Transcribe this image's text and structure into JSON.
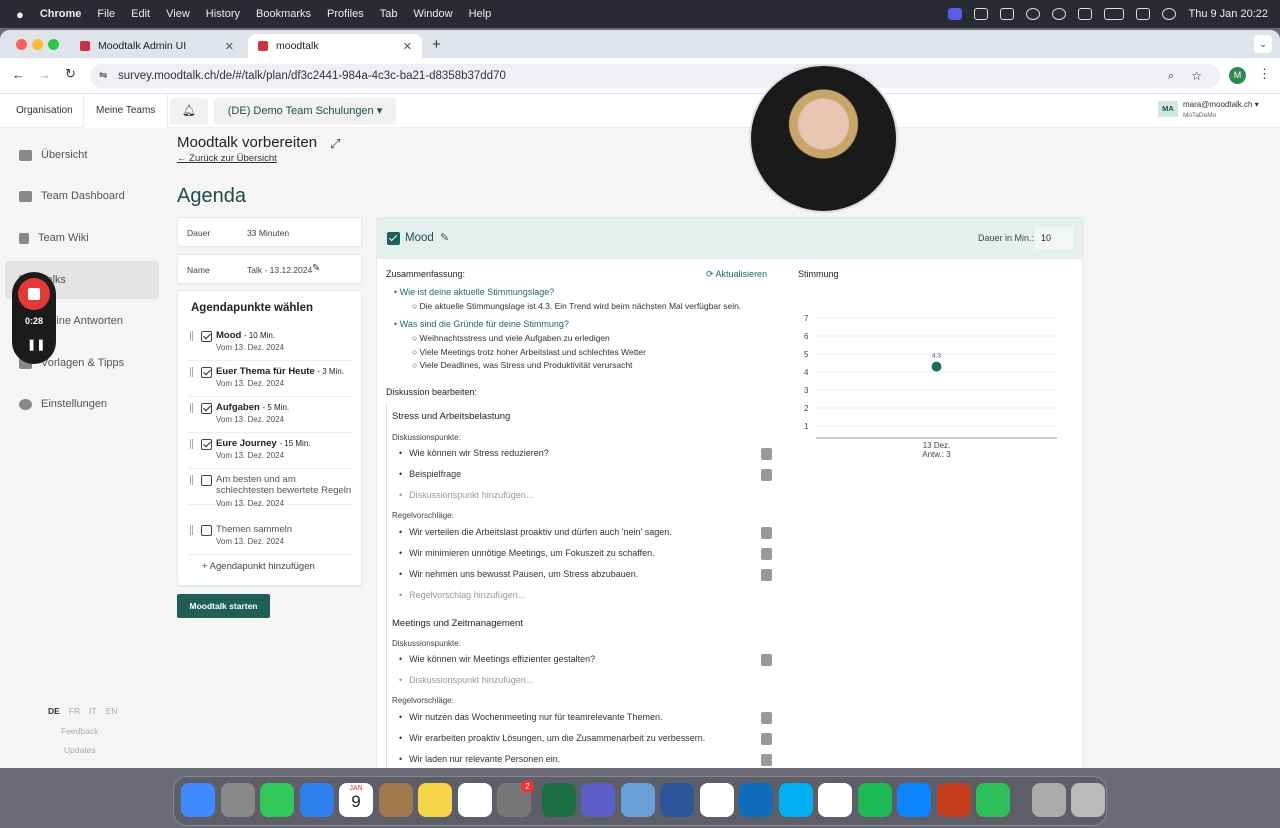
{
  "menubar": {
    "apple": "",
    "app": "Chrome",
    "items": [
      "File",
      "Edit",
      "View",
      "History",
      "Bookmarks",
      "Profiles",
      "Tab",
      "Window",
      "Help"
    ],
    "clock": "Thu 9 Jan  20:22"
  },
  "browser": {
    "tabs": [
      {
        "label": "Moodtalk Admin UI"
      },
      {
        "label": "moodtalk"
      }
    ],
    "url": "survey.moodtalk.ch/de/#/talk/plan/df3c2441-984a-4c3c-ba21-d8358b37dd70",
    "avatar": "M"
  },
  "topnav": {
    "tabs": [
      "Organisation",
      "Meine Teams"
    ],
    "team": "(DE) Demo Team Schulungen ▾",
    "user_initials": "MA",
    "user_email": "mara@moodtalk.ch ▾",
    "user_org": "MoTaDeMo"
  },
  "sidebar": {
    "items": [
      "Übersicht",
      "Team Dashboard",
      "Team Wiki",
      "Talks",
      "Meine Antworten",
      "Vorlagen & Tipps",
      "Einstellungen"
    ],
    "langs": [
      "DE",
      "FR",
      "IT",
      "EN"
    ],
    "feedback": "Feedback",
    "updates": "Updates"
  },
  "recorder": {
    "time": "0:28"
  },
  "page": {
    "title": "Moodtalk vorbereiten",
    "back": "← Zurück zur Übersicht",
    "heading": "Agenda"
  },
  "meta": {
    "duration_label": "Dauer",
    "duration_value": "33 Minuten",
    "name_label": "Name",
    "name_value": "Talk - 13.12.2024"
  },
  "agenda": {
    "title": "Agendapunkte wählen",
    "items": [
      {
        "title": "Mood",
        "dur": "10 Min.",
        "date": "Vom 13. Dez. 2024",
        "checked": true
      },
      {
        "title": "Euer Thema für Heute",
        "dur": "3 Min.",
        "date": "Vom 13. Dez. 2024",
        "checked": true
      },
      {
        "title": "Aufgaben",
        "dur": "5 Min.",
        "date": "Vom 13. Dez. 2024",
        "checked": true
      },
      {
        "title": "Eure Journey",
        "dur": "15 Min.",
        "date": "Vom 13. Dez. 2024",
        "checked": true
      },
      {
        "title": "Am besten und am schlechtesten bewertete Regeln",
        "dur": "",
        "date": "Vom 13. Dez. 2024",
        "checked": false
      },
      {
        "title": "Themen sammeln",
        "dur": "",
        "date": "Vom 13. Dez. 2024",
        "checked": false
      }
    ],
    "add": "+ Agendapunkt hinzufügen",
    "start": "Moodtalk starten"
  },
  "mood": {
    "title": "Mood",
    "duration_label": "Dauer in Min.:",
    "duration": "10",
    "summary_label": "Zusammenfassung:",
    "refresh": "Aktualisieren",
    "q1": "Wie ist deine aktuelle Stimmungslage?",
    "a1": "Die aktuelle Stimmungslage ist 4.3. Ein Trend wird beim nächsten Mal verfügbar sein.",
    "q2": "Was sind die Gründe für deine Stimmung?",
    "a2": [
      "Weihnachtsstress und viele Aufgaben zu erledigen",
      "Viele Meetings trotz hoher Arbeitslast und schlechtes Wetter",
      "Viele Deadlines, was Stress und Produktivität verursacht"
    ],
    "edit_label": "Diskussion bearbeiten:",
    "topics": [
      {
        "title": "Stress und Arbeitsbelastung",
        "points_label": "Diskussionspunkte:",
        "points": [
          "Wie können wir Stress reduzieren?",
          "Beispielfrage"
        ],
        "add_point": "Diskussionspunkt hinzufügen...",
        "rules_label": "Regelvorschläge:",
        "rules": [
          "Wir verteilen die Arbeitslast proaktiv und dürfen auch 'nein' sagen.",
          "Wir minimieren unnötige Meetings, um Fokuszeit zu schaffen.",
          "Wir nehmen uns bewusst Pausen, um Stress abzubauen."
        ],
        "add_rule": "Regelvorschlag hinzufügen..."
      },
      {
        "title": "Meetings und Zeitmanagement",
        "points_label": "Diskussionspunkte:",
        "points": [
          "Wie können wir Meetings effizienter gestalten?"
        ],
        "add_point": "Diskussionspunkt hinzufügen...",
        "rules_label": "Regelvorschläge:",
        "rules": [
          "Wir nutzen das Wochenmeeting nur für teamrelevante Themen.",
          "Wir erarbeiten proaktiv Lösungen, um die Zusammenarbeit zu verbessern.",
          "Wir laden nur relevante Personen ein."
        ]
      }
    ]
  },
  "chart_data": {
    "type": "scatter",
    "title": "Stimmung",
    "y_ticks": [
      "7",
      "6",
      "5",
      "4",
      "3",
      "2",
      "1"
    ],
    "ylim": [
      0,
      7
    ],
    "categories": [
      "13 Dez."
    ],
    "sub_labels": [
      "Antw.: 3"
    ],
    "values": [
      4.3
    ],
    "data_labels": [
      "4.3"
    ],
    "color": "#1f6b5e"
  },
  "dock": {
    "apps": [
      "finder",
      "launchpad",
      "messages",
      "mail",
      "calendar",
      "contacts",
      "notes",
      "freeform",
      "settings",
      "excel",
      "teams",
      "preview",
      "word",
      "chatgpt",
      "outlook",
      "skype",
      "chrome",
      "spotify",
      "safari",
      "powerpoint",
      "numbers",
      "help",
      "trash"
    ],
    "calendar_month": "JAN",
    "calendar_day": "9",
    "badge": "2"
  }
}
